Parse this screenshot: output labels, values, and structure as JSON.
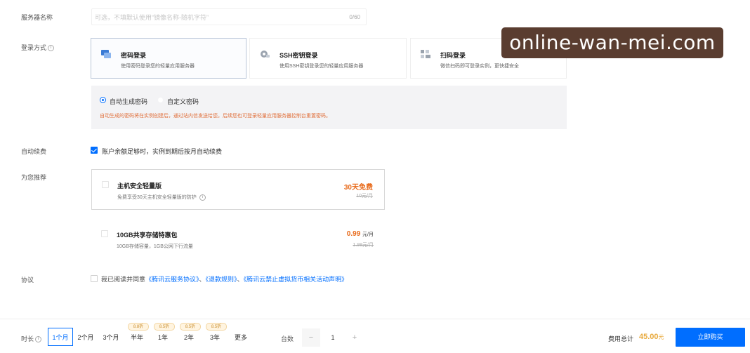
{
  "server_name": {
    "label": "服务器名称",
    "placeholder": "可选，不填默认使用“镜像名称-随机字符”",
    "counter": "0/60"
  },
  "login": {
    "label": "登录方式",
    "options": [
      {
        "title": "密码登录",
        "desc": "使用密码登录您的轻量应用服务器",
        "icon": "monitor-icon",
        "selected": true
      },
      {
        "title": "SSH密钥登录",
        "desc": "使用SSH密钥登录您的轻量应用服务器",
        "icon": "key-icon",
        "selected": false
      },
      {
        "title": "扫码登录",
        "desc": "微信扫码即可登录实例，更快捷安全",
        "icon": "qrcode-icon",
        "selected": false
      }
    ],
    "password_modes": [
      "自动生成密码",
      "自定义密码"
    ],
    "password_tip": "自动生成的密码将在实例创建后，通过站内信发送给您。后续您也可登录轻量应用服务器控制台重置密码。"
  },
  "auto_renew": {
    "label": "自动续费",
    "text": "账户余额足够时，实例到期后按月自动续费",
    "checked": true
  },
  "recommend": {
    "label": "为您推荐",
    "items": [
      {
        "title": "主机安全轻量版",
        "desc": "免费享受30天主机安全轻量版的防护",
        "price": "30天免费",
        "unit": "",
        "orig": "10元/月"
      },
      {
        "title": "10GB共享存储特惠包",
        "desc": "10GB存储容量，1GB公网下行流量",
        "price": "0.99",
        "unit": "元/月",
        "orig": "1.98元/月"
      }
    ]
  },
  "agreement": {
    "label": "协议",
    "prefix": "我已阅读并同意",
    "links": [
      "《腾讯云服务协议》",
      "《退款规则》",
      "《腾讯云禁止虚拟货币相关活动声明》"
    ],
    "sep": "、"
  },
  "bottom": {
    "duration_label": "时长",
    "durations": [
      "1个月",
      "2个月",
      "3个月",
      "半年",
      "1年",
      "2年",
      "3年",
      "更多"
    ],
    "discounts": [
      "8.8折",
      "8.5折",
      "8.5折",
      "8.5折"
    ],
    "qty_label": "台数",
    "qty": "1",
    "minus": "−",
    "plus": "+",
    "total_label": "费用总计",
    "total_value": "45.00",
    "total_unit": "元",
    "buy_label": "立即购买"
  },
  "watermark": "online-wan-mei.com",
  "colors": {
    "accent": "#006eff",
    "price": "#e86a1a",
    "total": "#e8a93c",
    "watermark_bg": "#5a3d30"
  }
}
